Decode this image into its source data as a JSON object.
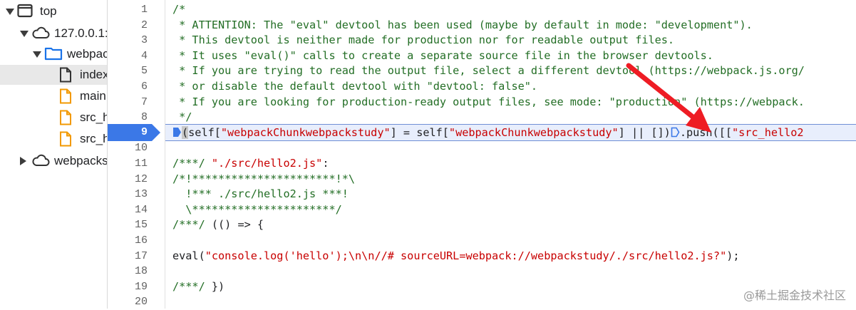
{
  "tree": [
    {
      "label": "top",
      "icon": "window-icon",
      "expand": "down",
      "indent": 0,
      "selected": false
    },
    {
      "label": "127.0.0.1:",
      "icon": "cloud-icon",
      "expand": "down",
      "indent": 1,
      "selected": false
    },
    {
      "label": "webpac",
      "icon": "folder-icon",
      "expand": "down",
      "indent": 2,
      "selected": false
    },
    {
      "label": "index",
      "icon": "file-icon",
      "expand": "none",
      "indent": 3,
      "selected": true
    },
    {
      "label": "main",
      "icon": "js-file-icon",
      "expand": "none",
      "indent": 3,
      "selected": false
    },
    {
      "label": "src_h",
      "icon": "js-file-icon",
      "expand": "none",
      "indent": 3,
      "selected": false
    },
    {
      "label": "src_h",
      "icon": "js-file-icon",
      "expand": "none",
      "indent": 3,
      "selected": false
    },
    {
      "label": "webpacks",
      "icon": "cloud-icon",
      "expand": "right",
      "indent": 1,
      "selected": false
    }
  ],
  "lines": [
    {
      "n": "1",
      "segs": [
        [
          "cmt",
          "/*"
        ]
      ]
    },
    {
      "n": "2",
      "segs": [
        [
          "cmt",
          " * ATTENTION: The \"eval\" devtool has been used (maybe by default in mode: \"development\")."
        ]
      ]
    },
    {
      "n": "3",
      "segs": [
        [
          "cmt",
          " * This devtool is neither made for production nor for readable output files."
        ]
      ]
    },
    {
      "n": "4",
      "segs": [
        [
          "cmt",
          " * It uses \"eval()\" calls to create a separate source file in the browser devtools."
        ]
      ]
    },
    {
      "n": "5",
      "segs": [
        [
          "cmt",
          " * If you are trying to read the output file, select a different devtool (https://webpack.js.org/"
        ]
      ]
    },
    {
      "n": "6",
      "segs": [
        [
          "cmt",
          " * or disable the default devtool with \"devtool: false\"."
        ]
      ]
    },
    {
      "n": "7",
      "segs": [
        [
          "cmt",
          " * If you are looking for production-ready output files, see mode: \"production\" (https://webpack."
        ]
      ]
    },
    {
      "n": "8",
      "segs": [
        [
          "cmt",
          " */"
        ]
      ]
    },
    {
      "n": "9",
      "active": true,
      "segs": [
        [
          "bp",
          ""
        ],
        [
          "hl",
          "("
        ],
        [
          "pl",
          "self["
        ],
        [
          "str",
          "\"webpackChunkwebpackstudy\""
        ],
        [
          "pl",
          "] = self["
        ],
        [
          "str",
          "\"webpackChunkwebpackstudy\""
        ],
        [
          "pl",
          "] || [])"
        ],
        [
          "bp",
          ""
        ],
        [
          "pl",
          ".push([["
        ],
        [
          "str",
          "\"src_hello2"
        ]
      ]
    },
    {
      "n": "10",
      "segs": []
    },
    {
      "n": "11",
      "segs": [
        [
          "cmt",
          "/***/ "
        ],
        [
          "str",
          "\"./src/hello2.js\""
        ],
        [
          "pl",
          ":"
        ]
      ]
    },
    {
      "n": "12",
      "segs": [
        [
          "cmt",
          "/*!**********************!*\\"
        ]
      ]
    },
    {
      "n": "13",
      "segs": [
        [
          "cmt",
          "  !*** ./src/hello2.js ***!"
        ]
      ]
    },
    {
      "n": "14",
      "segs": [
        [
          "cmt",
          "  \\**********************/"
        ]
      ]
    },
    {
      "n": "15",
      "segs": [
        [
          "cmt",
          "/***/ "
        ],
        [
          "pl",
          "(() => {"
        ]
      ]
    },
    {
      "n": "16",
      "segs": []
    },
    {
      "n": "17",
      "segs": [
        [
          "pl",
          "eval("
        ],
        [
          "str",
          "\"console.log('hello');\\n\\n//# sourceURL=webpack://webpackstudy/./src/hello2.js?\""
        ],
        [
          "pl",
          ");"
        ]
      ]
    },
    {
      "n": "18",
      "segs": []
    },
    {
      "n": "19",
      "segs": [
        [
          "cmt",
          "/***/ "
        ],
        [
          "pl",
          "})"
        ]
      ]
    },
    {
      "n": "20",
      "segs": []
    }
  ],
  "watermark": "@稀土掘金技术社区",
  "colors": {
    "comment": "#236e25",
    "string": "#c80000",
    "breakpoint": "#3b78e7",
    "arrow": "#ee1c24"
  }
}
